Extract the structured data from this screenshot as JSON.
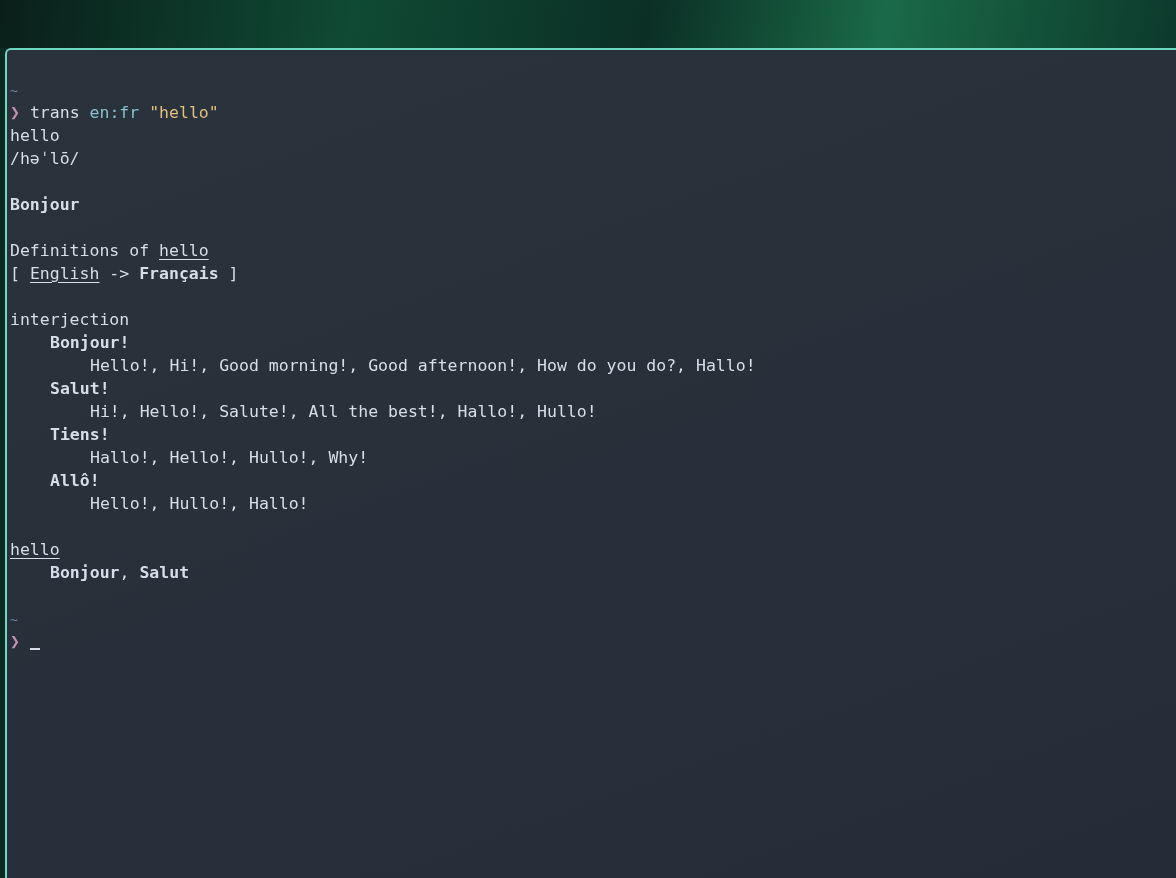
{
  "terminal": {
    "blocks": [
      {
        "kind": "path",
        "text": "~"
      },
      {
        "kind": "command",
        "symbol": "❯",
        "program": "trans",
        "language_pair": "en:fr",
        "argument": "\"hello\""
      },
      {
        "kind": "text",
        "segments": [
          {
            "text": "hello"
          }
        ]
      },
      {
        "kind": "text",
        "segments": [
          {
            "text": "/həˈlō/"
          }
        ]
      },
      {
        "kind": "blank"
      },
      {
        "kind": "text",
        "segments": [
          {
            "text": "Bonjour",
            "bold": true
          }
        ]
      },
      {
        "kind": "blank"
      },
      {
        "kind": "text",
        "segments": [
          {
            "text": "Definitions of "
          },
          {
            "text": "hello",
            "underline": true
          }
        ]
      },
      {
        "kind": "text",
        "segments": [
          {
            "text": "[ "
          },
          {
            "text": "English",
            "underline": true
          },
          {
            "text": " -> "
          },
          {
            "text": "Français",
            "bold": true
          },
          {
            "text": " ]"
          }
        ]
      },
      {
        "kind": "blank"
      },
      {
        "kind": "text",
        "segments": [
          {
            "text": "interjection"
          }
        ],
        "children": [
          {
            "kind": "text",
            "segments": [
              {
                "text": "Bonjour!",
                "bold": true
              }
            ],
            "children": [
              {
                "kind": "text",
                "segments": [
                  {
                    "text": "Hello!, Hi!, Good morning!, Good afternoon!, How do you do?, Hallo!"
                  }
                ]
              }
            ]
          },
          {
            "kind": "text",
            "segments": [
              {
                "text": "Salut!",
                "bold": true
              }
            ],
            "children": [
              {
                "kind": "text",
                "segments": [
                  {
                    "text": "Hi!, Hello!, Salute!, All the best!, Hallo!, Hullo!"
                  }
                ]
              }
            ]
          },
          {
            "kind": "text",
            "segments": [
              {
                "text": "Tiens!",
                "bold": true
              }
            ],
            "children": [
              {
                "kind": "text",
                "segments": [
                  {
                    "text": "Hallo!, Hello!, Hullo!, Why!"
                  }
                ]
              }
            ]
          },
          {
            "kind": "text",
            "segments": [
              {
                "text": "Allô!",
                "bold": true
              }
            ],
            "children": [
              {
                "kind": "text",
                "segments": [
                  {
                    "text": "Hello!, Hullo!, Hallo!"
                  }
                ]
              }
            ]
          }
        ]
      },
      {
        "kind": "blank"
      },
      {
        "kind": "text",
        "segments": [
          {
            "text": "hello",
            "underline": true
          }
        ],
        "children": [
          {
            "kind": "text",
            "segments": [
              {
                "text": "Bonjour",
                "bold": true
              },
              {
                "text": ", "
              },
              {
                "text": "Salut",
                "bold": true
              }
            ]
          }
        ]
      },
      {
        "kind": "blank"
      },
      {
        "kind": "path",
        "text": "~"
      },
      {
        "kind": "prompt",
        "symbol": "❯",
        "cursor": true
      }
    ]
  }
}
